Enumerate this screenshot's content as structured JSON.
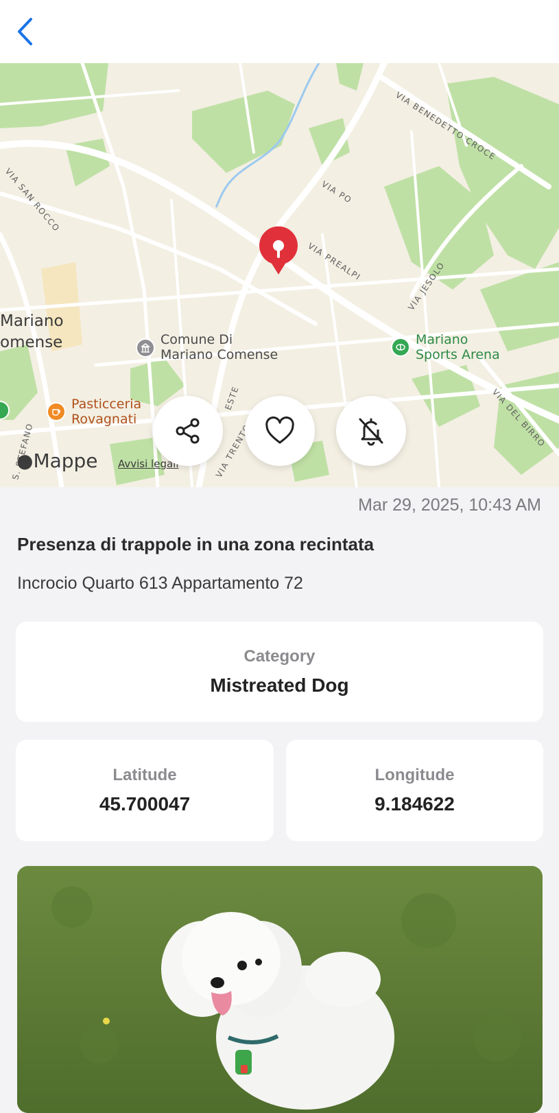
{
  "header": {
    "back_icon": "chevron-left-icon",
    "accent": "#1a73e8"
  },
  "map": {
    "streets": {
      "benedetto_croce": "VIA BENEDETTO CROCE",
      "san_rocco": "VIA SAN ROCCO",
      "po": "VIA PO",
      "prealpi": "VIA PREALPI",
      "jesolo": "VIA JESOLO",
      "del_birro": "VIA DEL BIRRO",
      "trento": "VIA TRENTO",
      "trieste": "ESTE",
      "stefano": "S. STEFANO"
    },
    "city_line1": "Mariano",
    "city_line2": "omense",
    "poi_comune_1": "Comune Di",
    "poi_comune_2": "Mariano Comense",
    "poi_sports_1": "Mariano",
    "poi_sports_2": "Sports Arena",
    "poi_pastry_1": "Pasticceria",
    "poi_pastry_2": "Rovagnati",
    "attribution": "Mappe",
    "legal": "Avvisi legali",
    "pin_color": "#e0313b"
  },
  "actions": {
    "share_icon": "share-icon",
    "favorite_icon": "heart-icon",
    "mute_icon": "bell-off-icon"
  },
  "report": {
    "date": "Mar 29, 2025, 10:43 AM",
    "title": "Presenza di trappole in una zona recintata",
    "address": "Incrocio Quarto 613 Appartamento 72"
  },
  "category": {
    "label": "Category",
    "value": "Mistreated Dog"
  },
  "coordinates": {
    "lat_label": "Latitude",
    "lat_value": "45.700047",
    "lon_label": "Longitude",
    "lon_value": "9.184622"
  }
}
